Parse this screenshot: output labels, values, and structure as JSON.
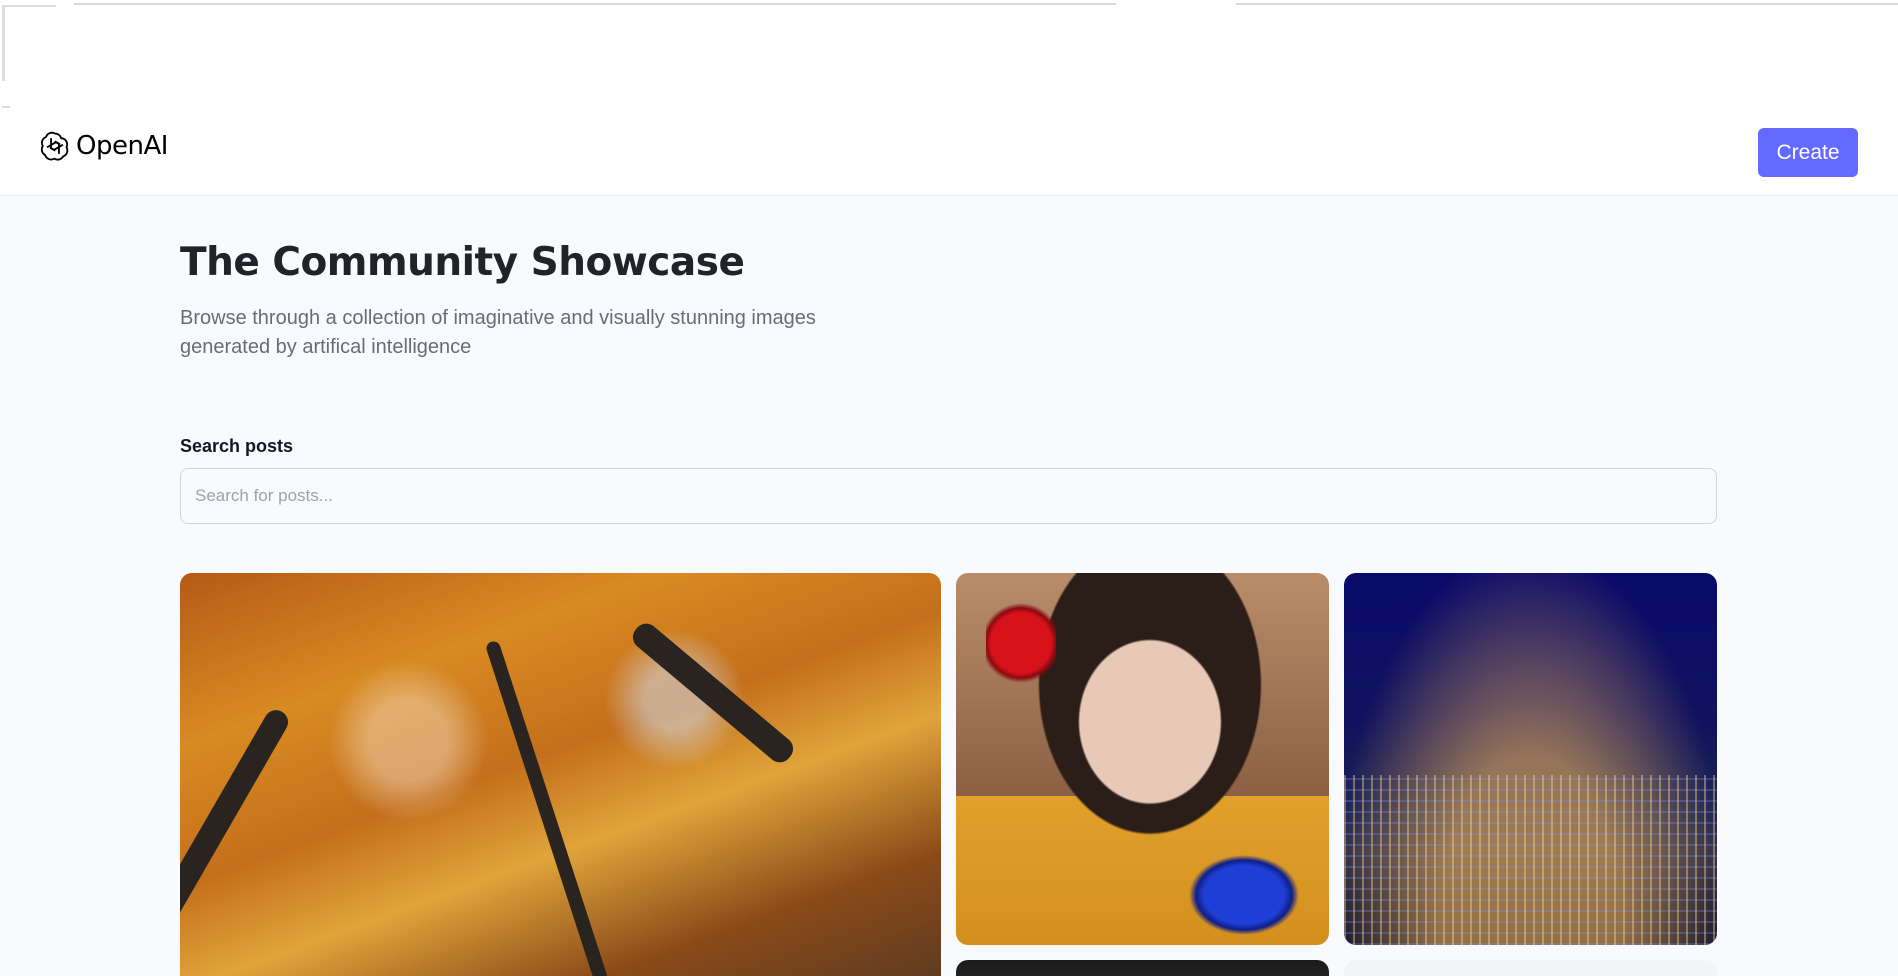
{
  "header": {
    "logo_text": "OpenAI",
    "create_label": "Create"
  },
  "hero": {
    "title": "The Community Showcase",
    "subtitle": "Browse through a collection of imaginative and visually stunning images generated by artifical intelligence"
  },
  "search": {
    "label": "Search posts",
    "placeholder": "Search for posts..."
  },
  "gallery": [
    {
      "name": "autumn-trees"
    },
    {
      "name": "portrait-with-flowers"
    },
    {
      "name": "city-at-night"
    },
    {
      "name": "dark-image"
    },
    {
      "name": "light-image"
    }
  ],
  "colors": {
    "accent": "#6469ff",
    "title": "#222328",
    "subtitle": "#666e75",
    "background": "#f9fafe"
  }
}
